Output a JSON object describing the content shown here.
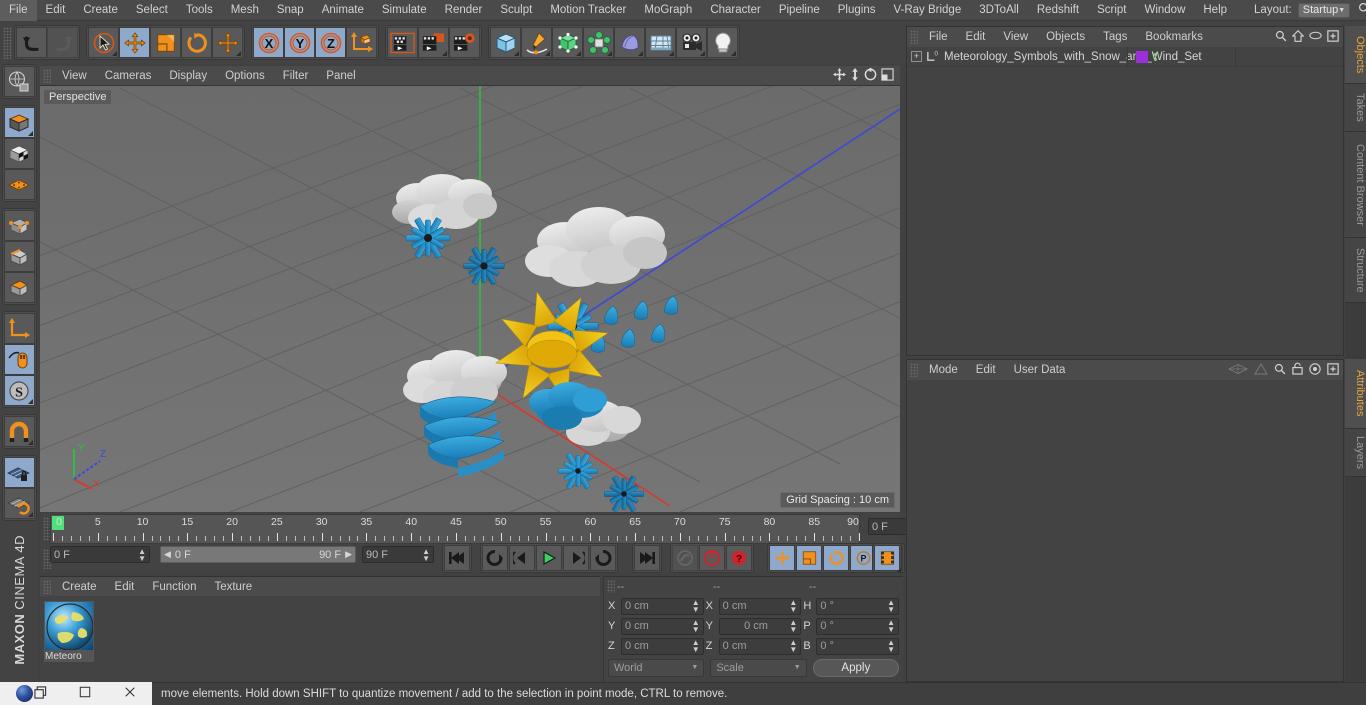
{
  "menubar": {
    "items": [
      "File",
      "Edit",
      "Create",
      "Select",
      "Tools",
      "Mesh",
      "Snap",
      "Animate",
      "Simulate",
      "Render",
      "Sculpt",
      "Motion Tracker",
      "MoGraph",
      "Character",
      "Pipeline",
      "Plugins",
      "V-Ray Bridge",
      "3DToAll",
      "Redshift",
      "Script",
      "Window",
      "Help"
    ],
    "layout_label": "Layout:",
    "layout_value": "Startup",
    "search_icon": "search-icon"
  },
  "toolbar": {
    "undo": "undo-icon",
    "redo": "redo-icon",
    "live_selection": "live-selection-icon",
    "move": "move-tool-icon",
    "scale": "scale-tool-icon",
    "rotate": "rotate-tool-icon",
    "move2": "move-axis-icon",
    "axis_x": "X",
    "axis_y": "Y",
    "axis_z": "Z",
    "world_axis": "world-coordinate-icon",
    "render_view": "render-view-icon",
    "render_region": "render-region-icon",
    "render_settings": "render-settings-icon",
    "cube": "add-cube-icon",
    "spline": "add-spline-icon",
    "nurbs": "generators-icon",
    "array": "deformers-icon",
    "scene": "scene-object-icon",
    "floor": "environment-icon",
    "camera": "camera-icon",
    "light": "light-icon"
  },
  "left_toolbar": {
    "items": [
      {
        "name": "make-editable-icon",
        "active": false
      },
      {
        "name": "model-mode-icon",
        "active": true
      },
      {
        "name": "texture-mode-icon",
        "active": false
      },
      {
        "name": "points-mode-icon",
        "active": false
      },
      {
        "name": "edges-mode-icon",
        "active": false
      },
      {
        "name": "polygons-mode-icon",
        "active": false
      },
      {
        "name": "object-axis-icon",
        "active": false
      },
      {
        "name": "world-axis-icon",
        "active": false
      },
      {
        "name": "enable-axis-icon",
        "active": true
      },
      {
        "name": "snap-settings-icon",
        "active": true
      },
      {
        "name": "magnet-icon",
        "active": false
      },
      {
        "name": "workplane-lock-icon",
        "active": true
      },
      {
        "name": "workplane-rotate-icon",
        "active": false
      }
    ],
    "brand_line1": "MAXON",
    "brand_line2": "CINEMA 4D"
  },
  "viewport": {
    "menu": [
      "View",
      "Cameras",
      "Display",
      "Options",
      "Filter",
      "Panel"
    ],
    "label": "Perspective",
    "grid_spacing": "Grid Spacing : 10 cm",
    "axis_labels": {
      "x": "X",
      "y": "Y",
      "z": "Z"
    },
    "controls": [
      "pan-icon",
      "dolly-icon",
      "rotate-view-icon",
      "maximize-viewport-icon"
    ],
    "scene_objects": [
      {
        "name": "cloud-with-snow-1",
        "type": "cloud+snow"
      },
      {
        "name": "cloud-with-snow-2",
        "type": "cloud+snow"
      },
      {
        "name": "cloud-with-rain-heavy",
        "type": "cloud+rain"
      },
      {
        "name": "cloud-with-wind",
        "type": "cloud+wind"
      },
      {
        "name": "sun-behind-cloud",
        "type": "sun+cloud"
      },
      {
        "name": "cloud-with-snow-3",
        "type": "cloud+snow"
      }
    ]
  },
  "timeline": {
    "ticks": [
      0,
      5,
      10,
      15,
      20,
      25,
      30,
      35,
      40,
      45,
      50,
      55,
      60,
      65,
      70,
      75,
      80,
      85,
      90
    ],
    "current_frame": "0 F",
    "range_start": "0 F",
    "range_end": "90 F",
    "end_frame": "90 F",
    "preview_frame": "0 F",
    "transport": [
      "go-to-start-icon",
      "play-reverse-loop-icon",
      "step-back-icon",
      "play-icon",
      "step-forward-icon",
      "play-forward-loop-icon",
      "go-to-end-icon"
    ],
    "record_tools": [
      "autokey-icon",
      "record-active-objects-icon",
      "record-help-icon"
    ],
    "key_tools": [
      "key-position-icon",
      "key-scale-icon",
      "key-rotation-icon",
      "key-param-icon",
      "key-pla-icon",
      "timeline-icon"
    ]
  },
  "material_manager": {
    "menu": [
      "Create",
      "Edit",
      "Function",
      "Texture"
    ],
    "materials": [
      {
        "name": "Meteoro",
        "full_name": "Meteorology"
      }
    ]
  },
  "coordinates": {
    "header": [
      "--",
      "--",
      "--"
    ],
    "rows": [
      {
        "pos_label": "X",
        "pos_value": "0 cm",
        "size_label": "X",
        "size_value": "0 cm",
        "rot_label": "H",
        "rot_value": "0 °"
      },
      {
        "pos_label": "Y",
        "pos_value": "0 cm",
        "size_label": "Y",
        "size_value": "0 cm",
        "rot_label": "P",
        "rot_value": "0 °"
      },
      {
        "pos_label": "Z",
        "pos_value": "0 cm",
        "size_label": "Z",
        "size_value": "0 cm",
        "rot_label": "B",
        "rot_value": "0 °"
      }
    ],
    "coord_system": "World",
    "mode": "Scale",
    "apply": "Apply"
  },
  "object_manager": {
    "menu": [
      "File",
      "Edit",
      "View",
      "Objects",
      "Tags",
      "Bookmarks"
    ],
    "icons": [
      "search-icon",
      "home-icon",
      "eye-icon",
      "add-layer-icon"
    ],
    "objects": [
      {
        "name": "Meteorology_Symbols_with_Snow_and_Wind_Set",
        "layer_color": "#9b2fd8",
        "expander": "+",
        "null_icon": "null-object-icon"
      }
    ]
  },
  "attributes_manager": {
    "menu": [
      "Mode",
      "Edit",
      "User Data"
    ],
    "icons": [
      "prev-object-icon",
      "pin-object-icon",
      "search-icon",
      "lock-icon",
      "target-icon",
      "add-tab-icon"
    ]
  },
  "right_tabs": [
    {
      "label": "Objects",
      "active": true
    },
    {
      "label": "Takes",
      "active": false
    },
    {
      "label": "Content Browser",
      "active": false
    },
    {
      "label": "Structure",
      "active": false
    },
    {
      "label": "Attributes",
      "active": true
    },
    {
      "label": "Layers",
      "active": false
    }
  ],
  "statusbar": {
    "message": "move elements. Hold down SHIFT to quantize movement / add to the selection in point mode, CTRL to remove.",
    "taskbar": [
      "c4d-app-icon",
      "window-restore-icon",
      "window-maximize-icon",
      "window-close-icon"
    ]
  },
  "colors": {
    "accent": "#e8a33d",
    "selection_blue": "#8fa9cc",
    "orange": "#f0911e",
    "panel": "#434343",
    "cloud_white": "#e2e2e2",
    "snow_blue": "#2a9ad8",
    "sun_yellow": "#f2c314"
  }
}
